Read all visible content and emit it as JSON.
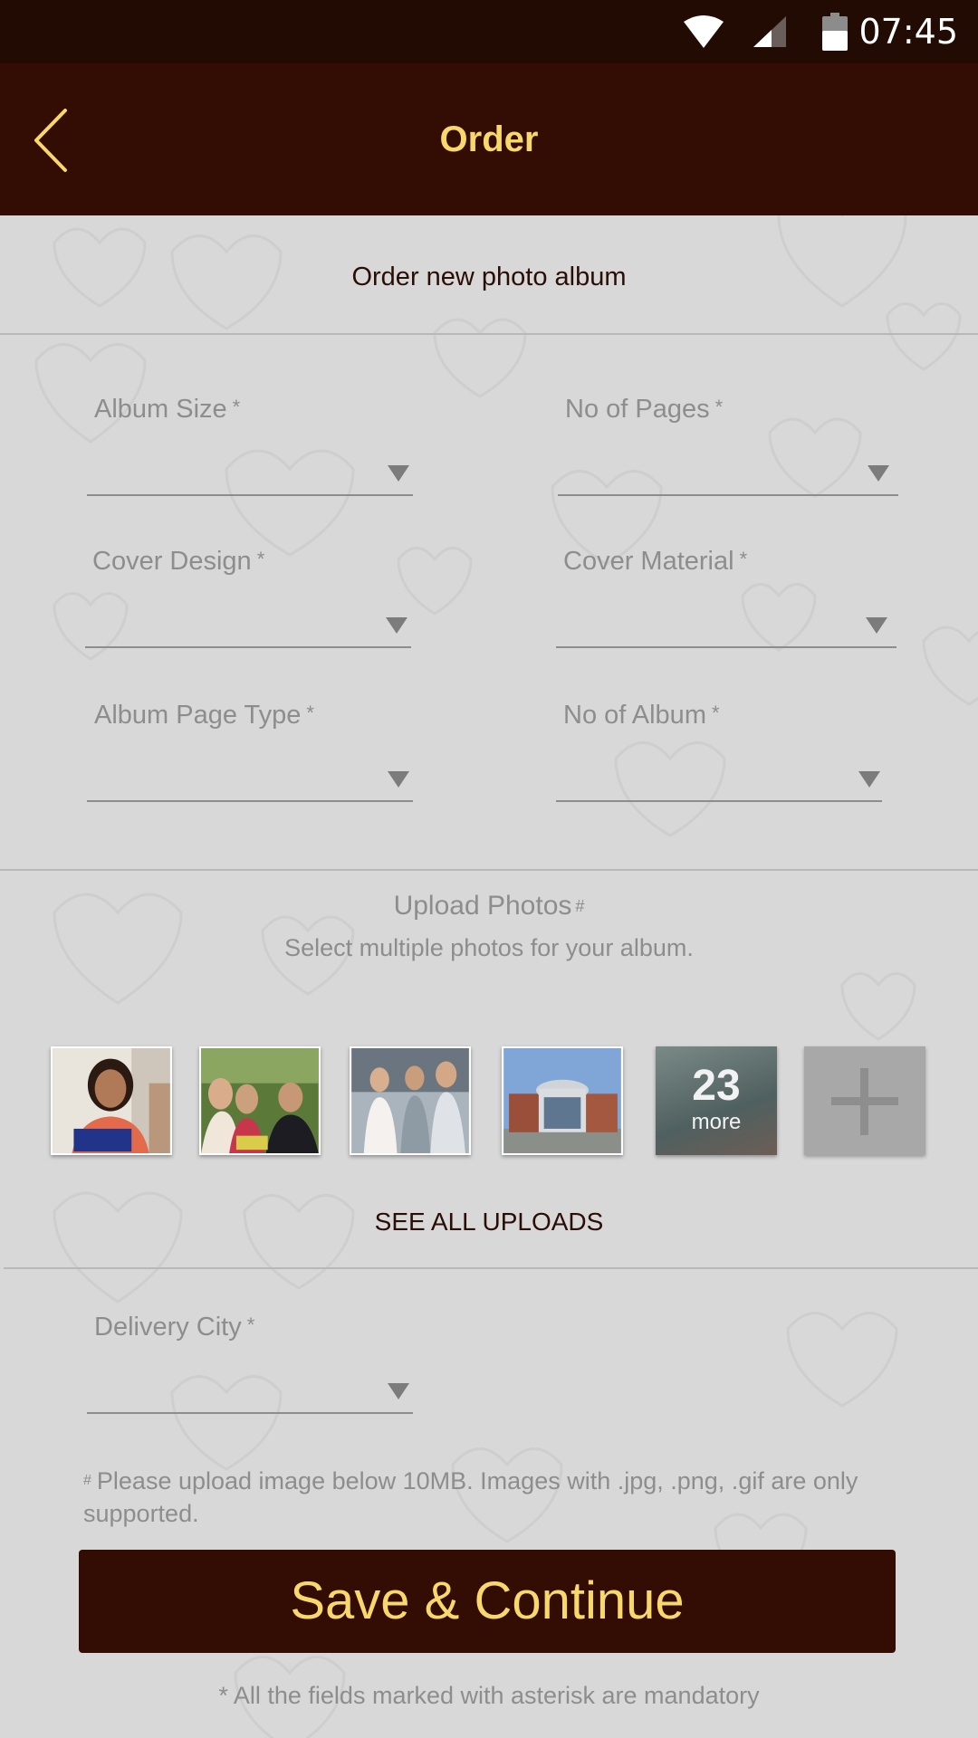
{
  "status_bar": {
    "time": "07:45",
    "icons": [
      "wifi-icon",
      "cell-signal-icon",
      "battery-icon"
    ]
  },
  "app_bar": {
    "title": "Order",
    "back_icon": "chevron-left-icon"
  },
  "form": {
    "section_title": "Order new photo album",
    "fields": [
      {
        "label": "Album Size",
        "required_mark": "*",
        "value": ""
      },
      {
        "label": "No of Pages",
        "required_mark": "*",
        "value": ""
      },
      {
        "label": "Cover Design",
        "required_mark": "*",
        "value": ""
      },
      {
        "label": "Cover Material",
        "required_mark": "*",
        "value": ""
      },
      {
        "label": "Album Page Type",
        "required_mark": "*",
        "value": ""
      },
      {
        "label": "No of Album",
        "required_mark": "*",
        "value": ""
      }
    ]
  },
  "upload": {
    "title": "Upload Photos",
    "title_mark": "#",
    "subtitle": "Select multiple photos for your album.",
    "more_count": "23",
    "more_label": "more",
    "see_all_label": "SEE ALL UPLOADS"
  },
  "delivery": {
    "label": "Delivery City",
    "required_mark": "*",
    "value": ""
  },
  "note": {
    "mark": "#",
    "text": "Please upload image below 10MB. Images with .jpg, .png, .gif are only supported."
  },
  "save_button": {
    "label": "Save & Continue"
  },
  "footnote": "* All the fields marked with asterisk are mandatory",
  "colors": {
    "primary_dark": "#330c03",
    "status_bar": "#220b03",
    "accent_yellow": "#f8d86a",
    "background": "#d9d8d8"
  }
}
